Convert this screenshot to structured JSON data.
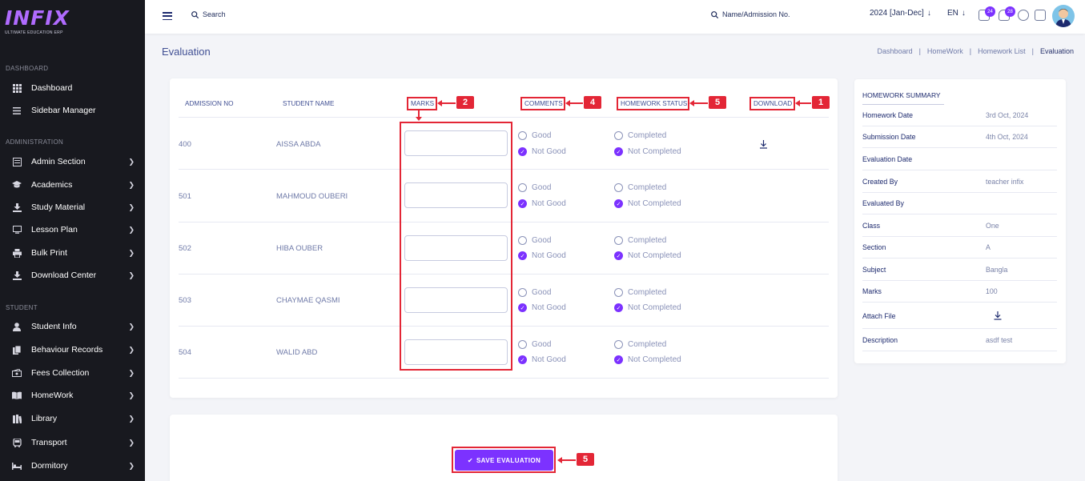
{
  "brand": {
    "logo_text": "INFIX",
    "logo_sub": "ULTIMATE EDUCATION ERP",
    "accent": "#7c32ff",
    "highlight": "#e32636"
  },
  "sidebar": {
    "sections": [
      {
        "label": "DASHBOARD"
      },
      {
        "label": "ADMINISTRATION"
      },
      {
        "label": "STUDENT"
      }
    ],
    "items": [
      {
        "label": "Dashboard",
        "icon": "grid-icon"
      },
      {
        "label": "Sidebar Manager",
        "icon": "menu-icon"
      },
      {
        "label": "Admin Section",
        "icon": "list-icon"
      },
      {
        "label": "Academics",
        "icon": "graduation-cap-icon"
      },
      {
        "label": "Study Material",
        "icon": "download-icon"
      },
      {
        "label": "Lesson Plan",
        "icon": "monitor-icon"
      },
      {
        "label": "Bulk Print",
        "icon": "printer-icon"
      },
      {
        "label": "Download Center",
        "icon": "download-icon"
      },
      {
        "label": "Student Info",
        "icon": "user-icon"
      },
      {
        "label": "Behaviour Records",
        "icon": "files-icon"
      },
      {
        "label": "Fees Collection",
        "icon": "money-icon"
      },
      {
        "label": "HomeWork",
        "icon": "book-icon"
      },
      {
        "label": "Library",
        "icon": "library-icon"
      },
      {
        "label": "Transport",
        "icon": "bus-icon"
      },
      {
        "label": "Dormitory",
        "icon": "bed-icon"
      }
    ]
  },
  "header": {
    "search_placeholder": "Search",
    "student_search_placeholder": "Name/Admission No.",
    "session": "2024 [Jan-Dec]",
    "language": "EN",
    "message_count": "24",
    "notification_count": "28"
  },
  "page": {
    "title": "Evaluation",
    "breadcrumb": [
      "Dashboard",
      "HomeWork",
      "Homework List",
      "Evaluation"
    ]
  },
  "table": {
    "headers": {
      "admission_no": "ADMISSION NO",
      "student_name": "STUDENT NAME",
      "marks": "MARKS",
      "comments": "COMMENTS",
      "homework_status": "HOMEWORK STATUS",
      "download": "DOWNLOAD"
    },
    "comment_options": [
      "Good",
      "Not Good"
    ],
    "status_options": [
      "Completed",
      "Not Completed"
    ],
    "rows": [
      {
        "admission_no": "400",
        "name": "AISSA ABDA",
        "marks": "",
        "comment": "Not Good",
        "status": "Not Completed"
      },
      {
        "admission_no": "501",
        "name": "MAHMOUD OUBERI",
        "marks": "",
        "comment": "Not Good",
        "status": "Not Completed"
      },
      {
        "admission_no": "502",
        "name": "HIBA OUBER",
        "marks": "",
        "comment": "Not Good",
        "status": "Not Completed"
      },
      {
        "admission_no": "503",
        "name": "CHAYMAE QASMI",
        "marks": "",
        "comment": "Not Good",
        "status": "Not Completed"
      },
      {
        "admission_no": "504",
        "name": "WALID ABD",
        "marks": "",
        "comment": "Not Good",
        "status": "Not Completed"
      }
    ]
  },
  "annotations": {
    "marks": "2",
    "comments": "4",
    "homework_status": "5",
    "download": "1",
    "save": "5"
  },
  "summary": {
    "title": "HOMEWORK SUMMARY",
    "rows": [
      {
        "label": "Homework Date",
        "value": "3rd Oct, 2024"
      },
      {
        "label": "Submission Date",
        "value": "4th Oct, 2024"
      },
      {
        "label": "Evaluation Date",
        "value": ""
      },
      {
        "label": "Created By",
        "value": "teacher infix"
      },
      {
        "label": "Evaluated By",
        "value": ""
      },
      {
        "label": "Class",
        "value": "One"
      },
      {
        "label": "Section",
        "value": "A"
      },
      {
        "label": "Subject",
        "value": "Bangla"
      },
      {
        "label": "Marks",
        "value": "100"
      },
      {
        "label": "Attach File",
        "value": ""
      },
      {
        "label": "Description",
        "value": "asdf test"
      }
    ]
  },
  "save_button": "SAVE EVALUATION"
}
